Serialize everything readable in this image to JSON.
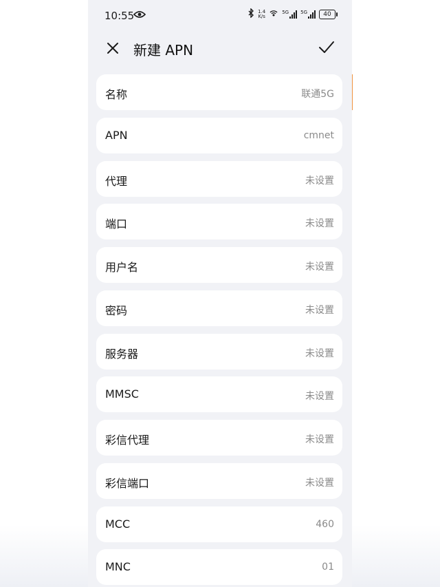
{
  "status_bar": {
    "time": "10:55",
    "net_speed_top": "1.4",
    "net_speed_bottom": "K/s",
    "sim1_label": "5G",
    "sim2_label": "5G",
    "battery": "40",
    "icons": [
      "eye-icon",
      "bluetooth-icon",
      "hotspot-icon",
      "signal-icon",
      "battery-icon"
    ]
  },
  "header": {
    "title": "新建 APN",
    "close_icon": "close-icon",
    "confirm_icon": "check-icon"
  },
  "fields": [
    {
      "label": "名称",
      "value": "联通5G",
      "highlighted": true
    },
    {
      "label": "APN",
      "value": "cmnet",
      "highlighted": true
    },
    {
      "label": "代理",
      "value": "未设置"
    },
    {
      "label": "端口",
      "value": "未设置"
    },
    {
      "label": "用户名",
      "value": "未设置"
    },
    {
      "label": "密码",
      "value": "未设置"
    },
    {
      "label": "服务器",
      "value": "未设置"
    },
    {
      "label": "MMSC",
      "value": "未设置"
    },
    {
      "label": "彩信代理",
      "value": "未设置"
    },
    {
      "label": "彩信端口",
      "value": "未设置"
    },
    {
      "label": "MCC",
      "value": "460"
    },
    {
      "label": "MNC",
      "value": "01"
    }
  ],
  "colors": {
    "highlight": "#f0923d",
    "page_bg": "#f1f2f6",
    "card_bg": "#ffffff",
    "value_text": "#8a8a8a"
  }
}
